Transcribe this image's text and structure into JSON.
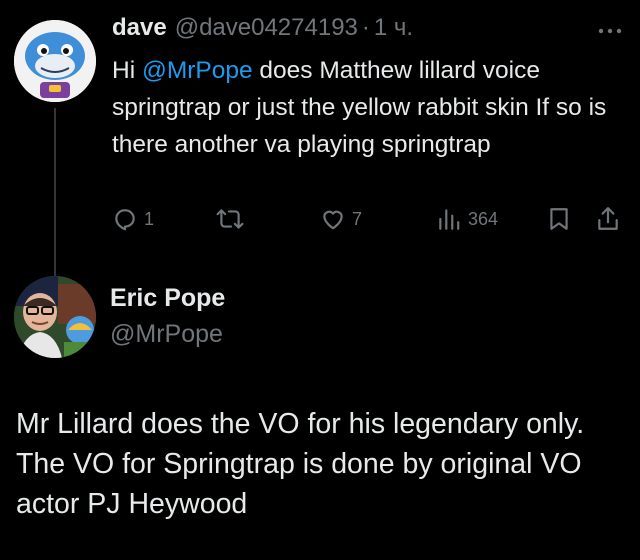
{
  "original_tweet": {
    "display_name": "dave",
    "handle": "@dave04274193",
    "separator": "·",
    "time": "1 ч.",
    "text_greeting": "Hi ",
    "mention": "@MrPope",
    "text_rest": " does Matthew lillard voice springtrap or just the yellow rabbit skin If so is there another va playing springtrap",
    "actions": {
      "replies": "1",
      "retweets": "",
      "likes": "7",
      "views": "364"
    }
  },
  "reply_tweet": {
    "display_name": "Eric Pope",
    "handle": "@MrPope",
    "text": "Mr Lillard does the VO for his legendary only. The VO for Springtrap is done by original VO actor PJ Heywood"
  },
  "icons": {
    "more": "more-icon",
    "reply": "reply-icon",
    "retweet": "retweet-icon",
    "like": "heart-icon",
    "views": "views-icon",
    "bookmark": "bookmark-icon",
    "share": "share-icon"
  },
  "colors": {
    "background": "#000000",
    "text_primary": "#e7e9ea",
    "text_secondary": "#71767b",
    "mention": "#1d9bf0"
  }
}
